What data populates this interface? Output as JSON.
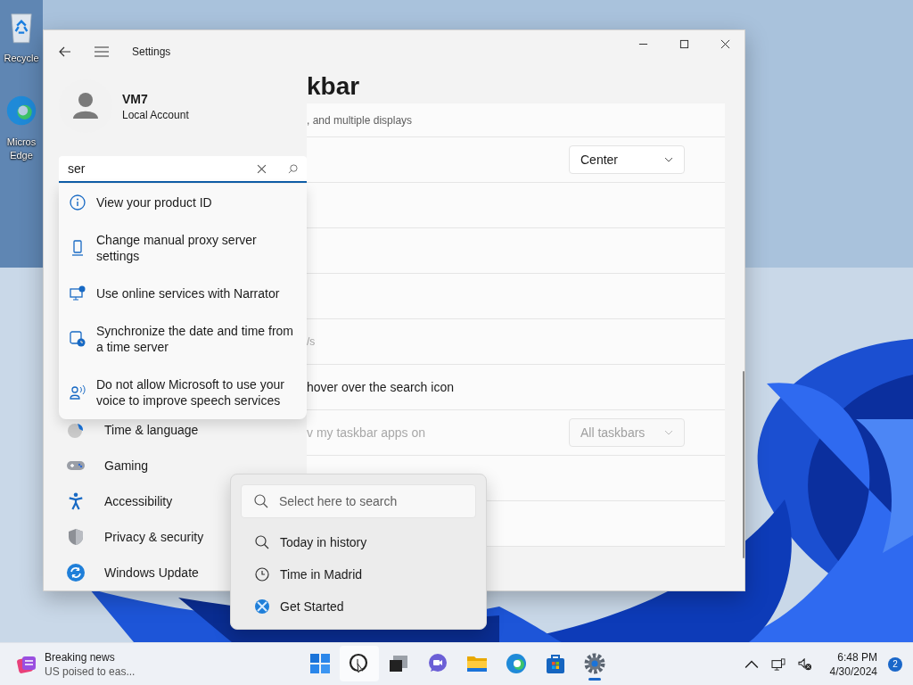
{
  "desktop": {
    "icons": [
      {
        "kind": "recycle",
        "lines": [
          "Recycle"
        ]
      },
      {
        "kind": "edge",
        "lines": [
          "Micros",
          "Edge"
        ]
      }
    ]
  },
  "window": {
    "title": "Settings",
    "account": {
      "name": "VM7",
      "type": "Local Account"
    },
    "search": {
      "value": "ser"
    },
    "search_results": [
      {
        "kind": "info",
        "text": "View your product ID"
      },
      {
        "kind": "proxy",
        "text": "Change manual proxy server settings"
      },
      {
        "kind": "narrator",
        "text": "Use online services with Narrator"
      },
      {
        "kind": "clock",
        "text": "Synchronize the date and time from a time server"
      },
      {
        "kind": "voice",
        "text": "Do not allow Microsoft to use your voice to improve speech services"
      }
    ],
    "nav": [
      {
        "kind": "time",
        "label": "Time & language"
      },
      {
        "kind": "gaming",
        "label": "Gaming"
      },
      {
        "kind": "accessibility",
        "label": "Accessibility"
      },
      {
        "kind": "privacy",
        "label": "Privacy & security"
      },
      {
        "kind": "update",
        "label": "Windows Update"
      }
    ],
    "page_title": "kbar",
    "rows": [
      {
        "text": ", and multiple displays",
        "disabled": false,
        "sub": true
      },
      {
        "dropdown": {
          "value": "Center",
          "disabled": false
        }
      },
      {},
      {},
      {},
      {
        "text": "/s",
        "disabled": true,
        "sub": true
      },
      {
        "text": "hover over the search icon",
        "disabled": false,
        "sub": false
      },
      {
        "text": "v my taskbar apps on",
        "disabled": true,
        "sub": false,
        "dropdown": {
          "value": "All taskbars",
          "disabled": true
        }
      },
      {},
      {}
    ]
  },
  "search_flyout": {
    "placeholder": "Select here to search",
    "items": [
      {
        "kind": "search",
        "label": "Today in history"
      },
      {
        "kind": "clock",
        "label": "Time in Madrid"
      },
      {
        "kind": "getstarted",
        "label": "Get Started"
      }
    ]
  },
  "taskbar": {
    "news": {
      "title": "Breaking news",
      "text": "US poised to eas..."
    },
    "apps": [
      {
        "kind": "start",
        "running": false,
        "hover": false
      },
      {
        "kind": "search",
        "running": false,
        "hover": true
      },
      {
        "kind": "taskview",
        "running": false,
        "hover": false
      },
      {
        "kind": "chat",
        "running": false,
        "hover": false
      },
      {
        "kind": "explorer",
        "running": false,
        "hover": false
      },
      {
        "kind": "edge",
        "running": false,
        "hover": false
      },
      {
        "kind": "store",
        "running": false,
        "hover": false
      },
      {
        "kind": "settings",
        "running": true,
        "hover": false
      }
    ],
    "time": "6:48 PM",
    "date": "4/30/2024",
    "notifications": "2"
  }
}
